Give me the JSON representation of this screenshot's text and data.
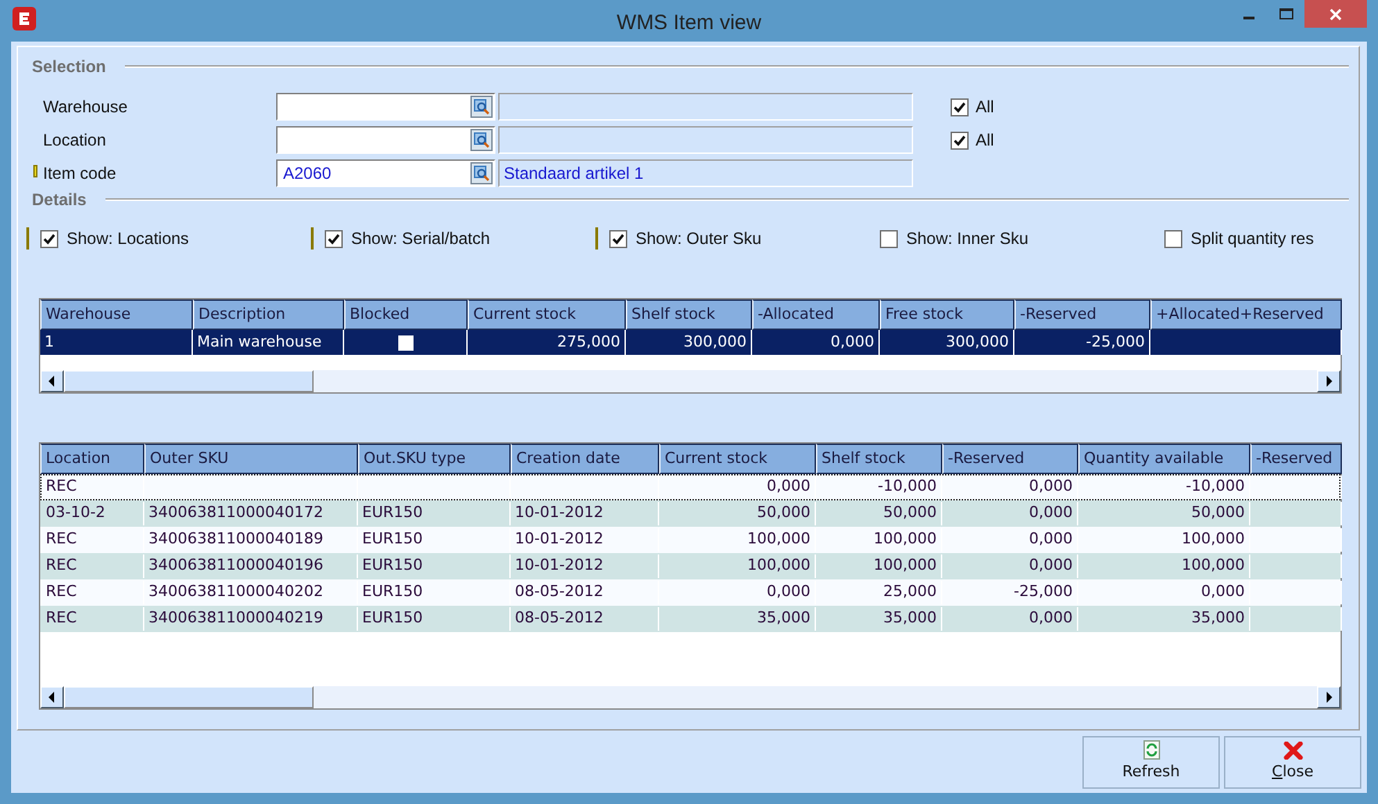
{
  "window": {
    "title": "WMS Item view"
  },
  "selection": {
    "heading": "Selection",
    "fields": [
      {
        "label": "Warehouse",
        "flagged": false,
        "all": {
          "label": "All",
          "checked": true
        }
      },
      {
        "label": "Location",
        "flagged": false,
        "all": {
          "label": "All",
          "checked": true
        }
      },
      {
        "label": "Item code",
        "value": "A2060",
        "description": "Standaard artikel 1",
        "flagged": true
      }
    ]
  },
  "details": {
    "heading": "Details",
    "options": [
      {
        "label": "Show: Locations",
        "checked": true,
        "flagged": true
      },
      {
        "label": "Show: Serial/batch",
        "checked": true,
        "flagged": true
      },
      {
        "label": "Show: Outer Sku",
        "checked": true,
        "flagged": true
      },
      {
        "label": "Show: Inner Sku",
        "checked": false,
        "flagged": false
      },
      {
        "label": "Split quantity res",
        "checked": false,
        "flagged": false
      }
    ]
  },
  "warehouse_table": {
    "columns": [
      "Warehouse",
      "Description",
      "Blocked",
      "Current stock",
      "Shelf stock",
      "-Allocated",
      "Free stock",
      "-Reserved",
      "+Allocated+Reserved"
    ],
    "rows": [
      {
        "selected": true,
        "warehouse": "1",
        "description": "Main warehouse",
        "blocked": false,
        "values": [
          "275,000",
          "300,000",
          "0,000",
          "300,000",
          "-25,000"
        ]
      }
    ]
  },
  "location_table": {
    "columns": [
      "Location",
      "Outer SKU",
      "Out.SKU type",
      "Creation date",
      "Current stock",
      "Shelf stock",
      "-Reserved",
      "Quantity available",
      "-Reserved"
    ],
    "rows": [
      {
        "focused": true,
        "cells": [
          "REC",
          null,
          null,
          null,
          "0,000",
          "-10,000",
          "0,000",
          "-10,000"
        ]
      },
      {
        "focused": false,
        "cells": [
          "03-10-2",
          "340063811000040172",
          "EUR150",
          "10-01-2012",
          "50,000",
          "50,000",
          "0,000",
          "50,000"
        ]
      },
      {
        "focused": false,
        "cells": [
          "REC",
          "340063811000040189",
          "EUR150",
          "10-01-2012",
          "100,000",
          "100,000",
          "0,000",
          "100,000"
        ]
      },
      {
        "focused": false,
        "cells": [
          "REC",
          "340063811000040196",
          "EUR150",
          "10-01-2012",
          "100,000",
          "100,000",
          "0,000",
          "100,000"
        ]
      },
      {
        "focused": false,
        "cells": [
          "REC",
          "340063811000040202",
          "EUR150",
          "08-05-2012",
          "0,000",
          "25,000",
          "-25,000",
          "0,000"
        ]
      },
      {
        "focused": false,
        "cells": [
          "REC",
          "340063811000040219",
          "EUR150",
          "08-05-2012",
          "35,000",
          "35,000",
          "0,000",
          "35,000"
        ]
      }
    ]
  },
  "buttons": [
    {
      "kind": "refresh",
      "label": "Refresh",
      "mnemonic_underlined": false
    },
    {
      "kind": "close",
      "label": "Close",
      "mnemonic_underlined": true
    }
  ]
}
